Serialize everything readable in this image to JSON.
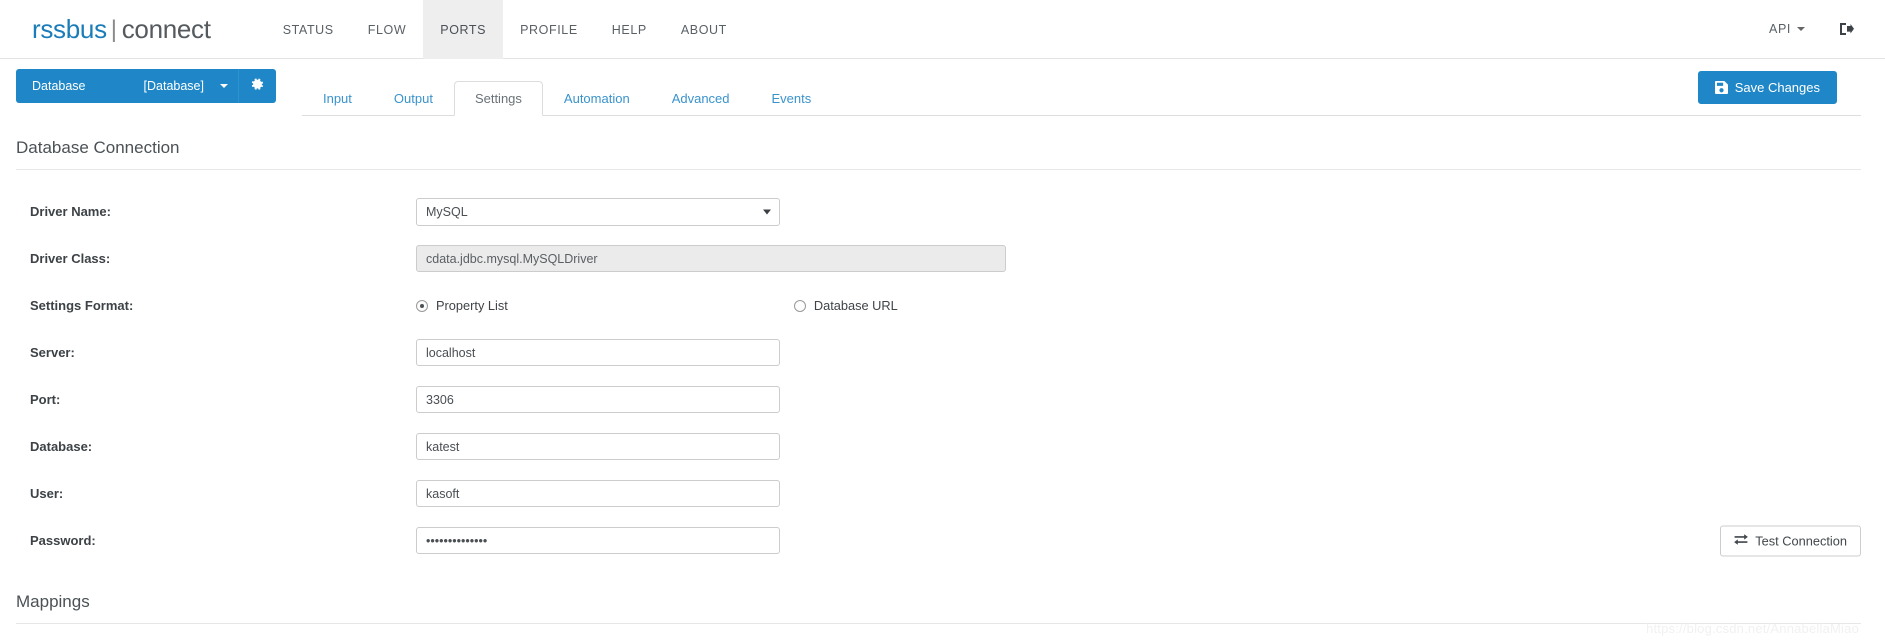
{
  "navbar": {
    "logo_primary": "rssbus",
    "logo_divider": "|",
    "logo_secondary": "connect",
    "items": [
      {
        "label": "STATUS",
        "active": false
      },
      {
        "label": "FLOW",
        "active": false
      },
      {
        "label": "PORTS",
        "active": true
      },
      {
        "label": "PROFILE",
        "active": false
      },
      {
        "label": "HELP",
        "active": false
      },
      {
        "label": "ABOUT",
        "active": false
      }
    ],
    "api_label": "API",
    "logout_icon": "logout-icon",
    "accent_color": "#1f87c7"
  },
  "portbar": {
    "port_name": "Database",
    "port_type": "[Database]",
    "gear_icon": "gear-icon",
    "tabs": [
      {
        "label": "Input",
        "active": false
      },
      {
        "label": "Output",
        "active": false
      },
      {
        "label": "Settings",
        "active": true
      },
      {
        "label": "Automation",
        "active": false
      },
      {
        "label": "Advanced",
        "active": false
      },
      {
        "label": "Events",
        "active": false
      }
    ],
    "save_label": "Save Changes",
    "save_icon": "save-icon"
  },
  "sections": {
    "database_connection_title": "Database Connection",
    "mappings_title": "Mappings"
  },
  "form": {
    "driver_name": {
      "label": "Driver Name:",
      "value": "MySQL",
      "options": [
        "MySQL"
      ]
    },
    "driver_class": {
      "label": "Driver Class:",
      "value": "cdata.jdbc.mysql.MySQLDriver",
      "disabled": true
    },
    "settings_format": {
      "label": "Settings Format:",
      "selected": "Property List",
      "options": [
        {
          "label": "Property List",
          "selected": true
        },
        {
          "label": "Database URL",
          "selected": false
        }
      ]
    },
    "server": {
      "label": "Server:",
      "value": "localhost"
    },
    "port": {
      "label": "Port:",
      "value": "3306"
    },
    "database": {
      "label": "Database:",
      "value": "katest"
    },
    "user": {
      "label": "User:",
      "value": "kasoft"
    },
    "password": {
      "label": "Password:",
      "value": "••••••••••••••"
    },
    "test_connection": {
      "label": "Test Connection",
      "icon": "exchange-arrows-icon"
    }
  },
  "watermark": "https://blog.csdn.net/AnnabellaMiao"
}
